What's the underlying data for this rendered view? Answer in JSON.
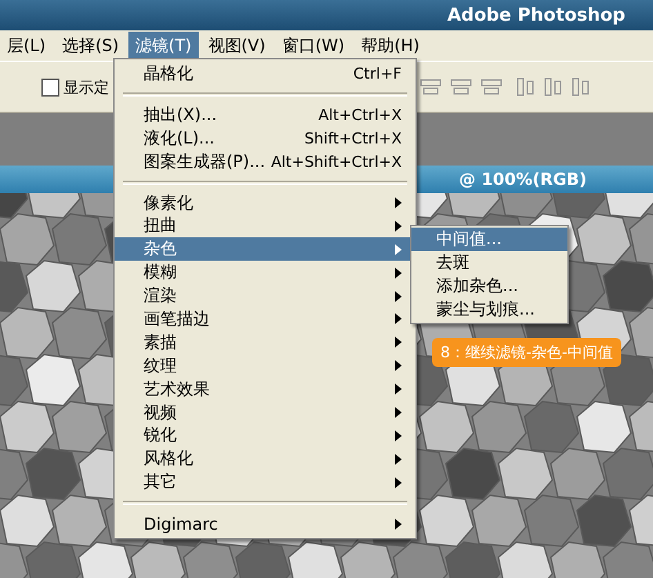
{
  "window": {
    "title": "Adobe Photoshop"
  },
  "menubar": [
    {
      "label": "层(L)",
      "selected": false
    },
    {
      "label": "选择(S)",
      "selected": false
    },
    {
      "label": "滤镜(T)",
      "selected": true
    },
    {
      "label": "视图(V)",
      "selected": false
    },
    {
      "label": "窗口(W)",
      "selected": false
    },
    {
      "label": "帮助(H)",
      "selected": false
    }
  ],
  "options_bar": {
    "checkbox": {
      "label": "显示定",
      "checked": false
    }
  },
  "document": {
    "title": "@ 100%(RGB)"
  },
  "filter_menu": [
    {
      "kind": "item",
      "label": "晶格化",
      "shortcut": "Ctrl+F"
    },
    {
      "kind": "separator"
    },
    {
      "kind": "item",
      "label": "抽出(X)...",
      "shortcut": "Alt+Ctrl+X"
    },
    {
      "kind": "item",
      "label": "液化(L)...",
      "shortcut": "Shift+Ctrl+X"
    },
    {
      "kind": "item",
      "label": "图案生成器(P)...",
      "shortcut": "Alt+Shift+Ctrl+X"
    },
    {
      "kind": "separator"
    },
    {
      "kind": "submenu",
      "label": "像素化",
      "selected": false
    },
    {
      "kind": "submenu",
      "label": "扭曲",
      "selected": false
    },
    {
      "kind": "submenu",
      "label": "杂色",
      "selected": true
    },
    {
      "kind": "submenu",
      "label": "模糊",
      "selected": false
    },
    {
      "kind": "submenu",
      "label": "渲染",
      "selected": false
    },
    {
      "kind": "submenu",
      "label": "画笔描边",
      "selected": false
    },
    {
      "kind": "submenu",
      "label": "素描",
      "selected": false
    },
    {
      "kind": "submenu",
      "label": "纹理",
      "selected": false
    },
    {
      "kind": "submenu",
      "label": "艺术效果",
      "selected": false
    },
    {
      "kind": "submenu",
      "label": "视频",
      "selected": false
    },
    {
      "kind": "submenu",
      "label": "锐化",
      "selected": false
    },
    {
      "kind": "submenu",
      "label": "风格化",
      "selected": false
    },
    {
      "kind": "submenu",
      "label": "其它",
      "selected": false
    },
    {
      "kind": "separator"
    },
    {
      "kind": "submenu",
      "label": "Digimarc",
      "selected": false
    }
  ],
  "noise_submenu": [
    {
      "label": "中间值...",
      "selected": true
    },
    {
      "label": "去斑",
      "selected": false
    },
    {
      "label": "添加杂色...",
      "selected": false
    },
    {
      "label": "蒙尘与划痕...",
      "selected": false
    }
  ],
  "step_badge": "8：继续滤镜-杂色-中间值"
}
